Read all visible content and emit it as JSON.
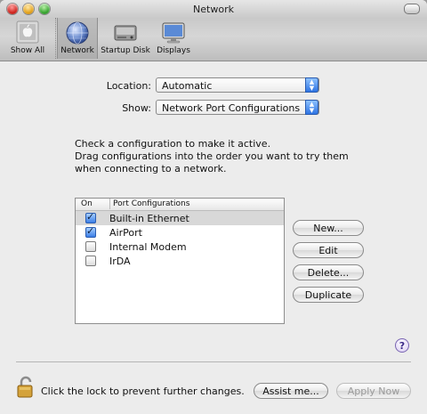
{
  "window": {
    "title": "Network"
  },
  "toolbar": {
    "items": [
      {
        "label": "Show All",
        "icon": "apple-icon"
      },
      {
        "label": "Network",
        "icon": "network-globe-icon",
        "selected": true
      },
      {
        "label": "Startup Disk",
        "icon": "hard-disk-icon"
      },
      {
        "label": "Displays",
        "icon": "display-monitor-icon"
      }
    ]
  },
  "form": {
    "location_label": "Location:",
    "location_value": "Automatic",
    "show_label": "Show:",
    "show_value": "Network Port Configurations"
  },
  "instructions": {
    "line1": "Check a configuration to make it active.",
    "line2": "Drag configurations into the order you want to try them when connecting to a network."
  },
  "table": {
    "headers": {
      "on": "On",
      "port": "Port Configurations"
    },
    "rows": [
      {
        "name": "Built-in Ethernet",
        "checked": true,
        "selected": true
      },
      {
        "name": "AirPort",
        "checked": true,
        "selected": false
      },
      {
        "name": "Internal Modem",
        "checked": false,
        "selected": false
      },
      {
        "name": "IrDA",
        "checked": false,
        "selected": false
      }
    ]
  },
  "buttons": {
    "new": "New...",
    "edit": "Edit",
    "delete": "Delete...",
    "duplicate": "Duplicate",
    "assist": "Assist me...",
    "apply": "Apply Now"
  },
  "help": {
    "label": "?"
  },
  "lock": {
    "text": "Click the lock to prevent further changes."
  },
  "colors": {
    "accent": "#2e74e3",
    "selected_row": "#d8d8d8"
  }
}
